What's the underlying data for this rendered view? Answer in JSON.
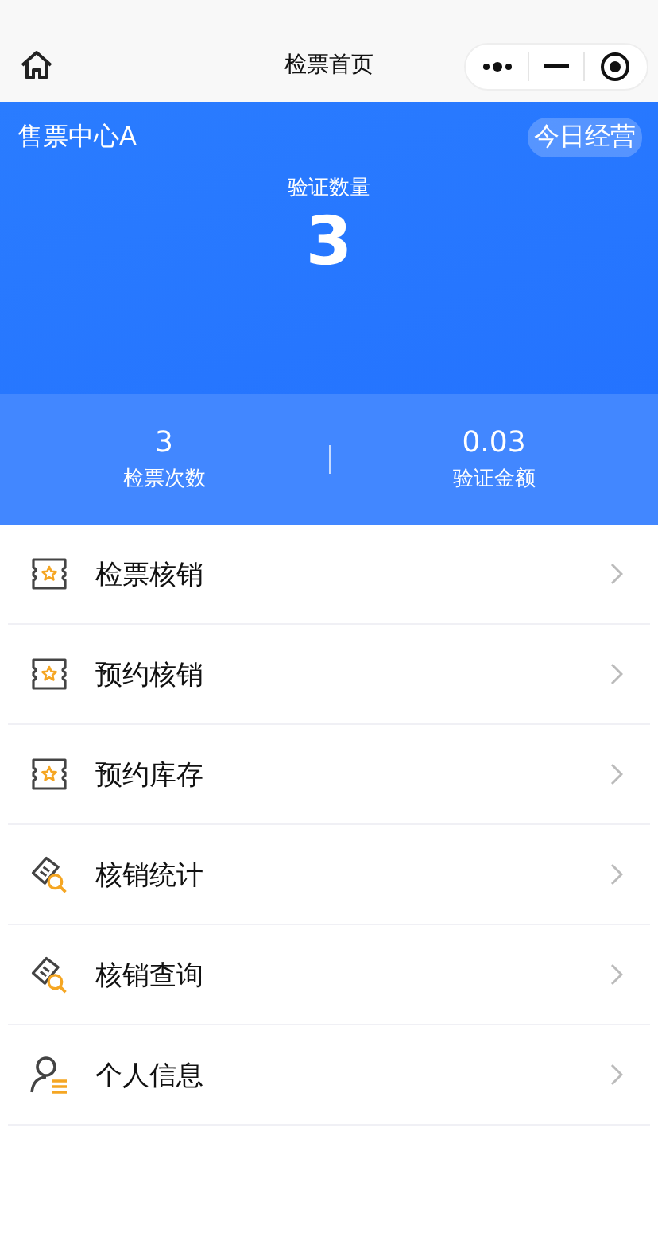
{
  "nav": {
    "title": "检票首页"
  },
  "header": {
    "venue": "售票中心A",
    "badge": "今日经营",
    "metric_label": "验证数量",
    "metric_value": "3"
  },
  "stats": [
    {
      "value": "3",
      "label": "检票次数"
    },
    {
      "value": "0.03",
      "label": "验证金额"
    }
  ],
  "menu": [
    {
      "kind": "ticket",
      "label": "检票核销"
    },
    {
      "kind": "ticket",
      "label": "预约核销"
    },
    {
      "kind": "ticket",
      "label": "预约库存"
    },
    {
      "kind": "search",
      "label": "核销统计"
    },
    {
      "kind": "search",
      "label": "核销查询"
    },
    {
      "kind": "user",
      "label": "个人信息"
    }
  ]
}
